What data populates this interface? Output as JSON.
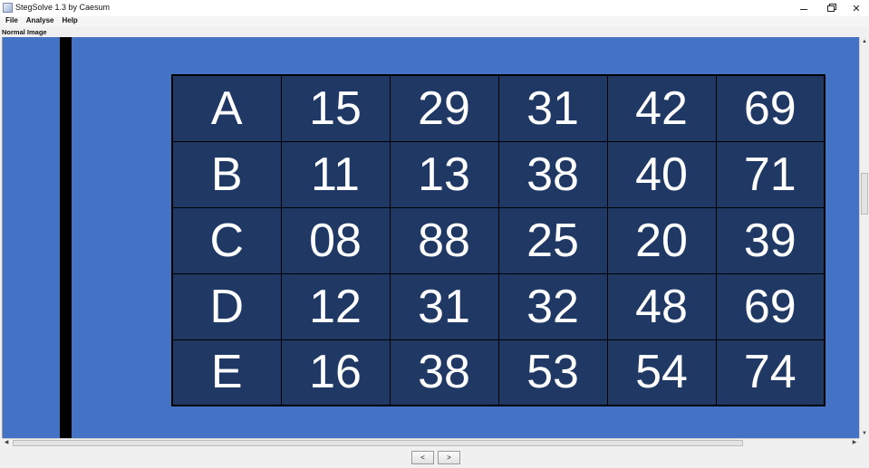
{
  "window": {
    "title": "StegSolve 1.3 by Caesum",
    "minimize_glyph": "",
    "close_glyph": "✕"
  },
  "menu": {
    "items": [
      "File",
      "Analyse",
      "Help"
    ]
  },
  "view_label": "Normal Image",
  "grid": {
    "rows": [
      [
        "A",
        "15",
        "29",
        "31",
        "42",
        "69"
      ],
      [
        "B",
        "11",
        "13",
        "38",
        "40",
        "71"
      ],
      [
        "C",
        "08",
        "88",
        "25",
        "20",
        "39"
      ],
      [
        "D",
        "12",
        "31",
        "32",
        "48",
        "69"
      ],
      [
        "E",
        "16",
        "38",
        "53",
        "54",
        "74"
      ]
    ]
  },
  "navigation": {
    "prev_label": "<",
    "next_label": ">"
  },
  "colors": {
    "canvas_background": "#4472c4",
    "cell_background": "#1f3864",
    "cell_text": "#ffffff",
    "cell_border": "#000000"
  }
}
